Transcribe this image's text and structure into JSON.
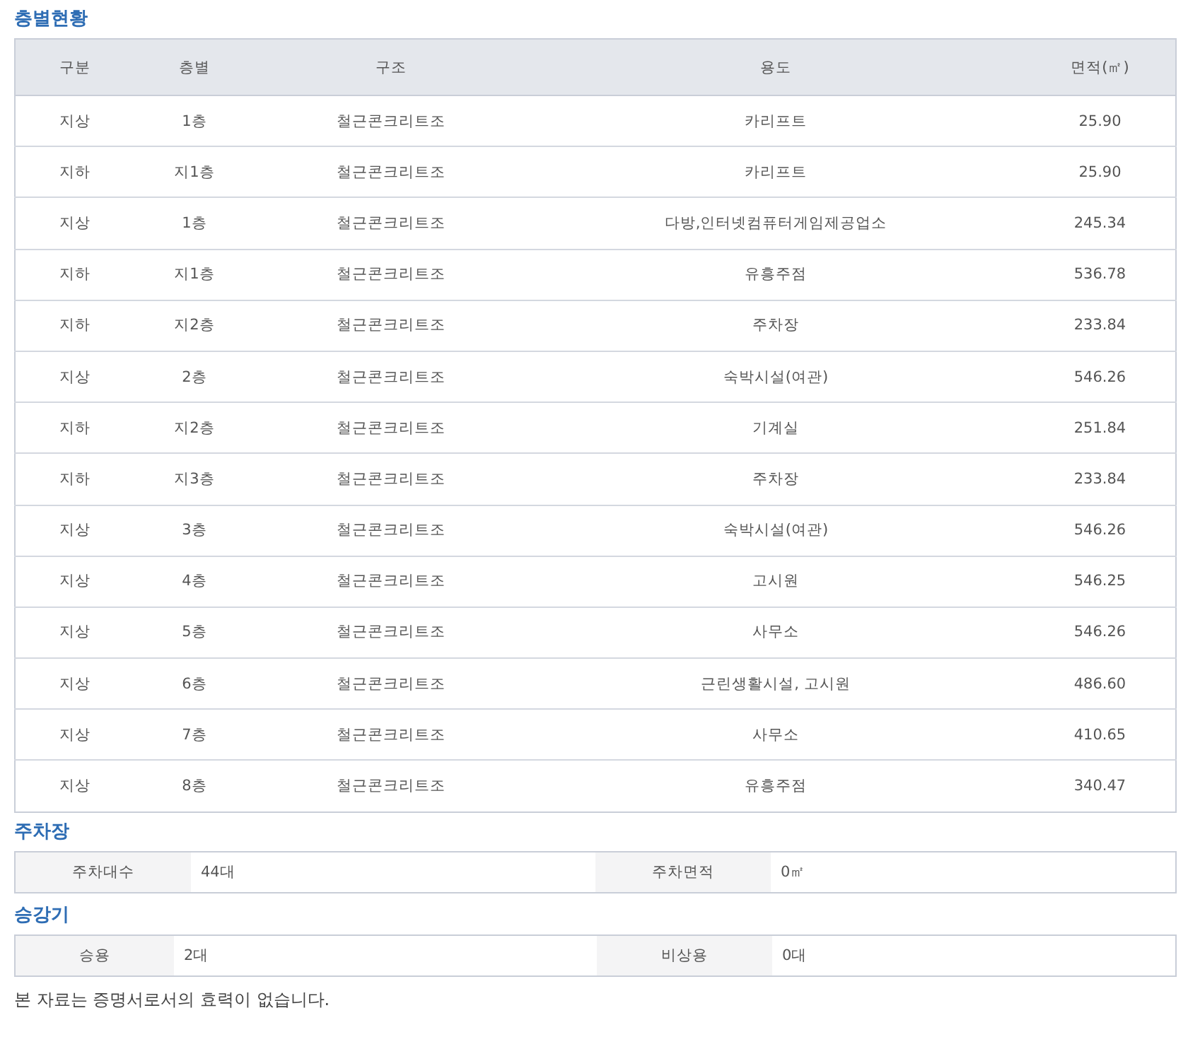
{
  "floors": {
    "title": "층별현황",
    "columns": [
      "구분",
      "층별",
      "구조",
      "용도",
      "면적(㎡)"
    ],
    "rows": [
      [
        "지상",
        "1층",
        "철근콘크리트조",
        "카리프트",
        "25.90"
      ],
      [
        "지하",
        "지1층",
        "철근콘크리트조",
        "카리프트",
        "25.90"
      ],
      [
        "지상",
        "1층",
        "철근콘크리트조",
        "다방,인터넷컴퓨터게임제공업소",
        "245.34"
      ],
      [
        "지하",
        "지1층",
        "철근콘크리트조",
        "유흥주점",
        "536.78"
      ],
      [
        "지하",
        "지2층",
        "철근콘크리트조",
        "주차장",
        "233.84"
      ],
      [
        "지상",
        "2층",
        "철근콘크리트조",
        "숙박시설(여관)",
        "546.26"
      ],
      [
        "지하",
        "지2층",
        "철근콘크리트조",
        "기계실",
        "251.84"
      ],
      [
        "지하",
        "지3층",
        "철근콘크리트조",
        "주차장",
        "233.84"
      ],
      [
        "지상",
        "3층",
        "철근콘크리트조",
        "숙박시설(여관)",
        "546.26"
      ],
      [
        "지상",
        "4층",
        "철근콘크리트조",
        "고시원",
        "546.25"
      ],
      [
        "지상",
        "5층",
        "철근콘크리트조",
        "사무소",
        "546.26"
      ],
      [
        "지상",
        "6층",
        "철근콘크리트조",
        "근린생활시설, 고시원",
        "486.60"
      ],
      [
        "지상",
        "7층",
        "철근콘크리트조",
        "사무소",
        "410.65"
      ],
      [
        "지상",
        "8층",
        "철근콘크리트조",
        "유흥주점",
        "340.47"
      ]
    ]
  },
  "parking": {
    "title": "주차장",
    "fields": [
      {
        "label": "주차대수",
        "value": "44대"
      },
      {
        "label": "주차면적",
        "value": "0㎡"
      }
    ]
  },
  "elevator": {
    "title": "승강기",
    "fields": [
      {
        "label": "승용",
        "value": "2대"
      },
      {
        "label": "비상용",
        "value": "0대"
      }
    ]
  },
  "notice": "본 자료는 증명서로서의 효력이 없습니다."
}
